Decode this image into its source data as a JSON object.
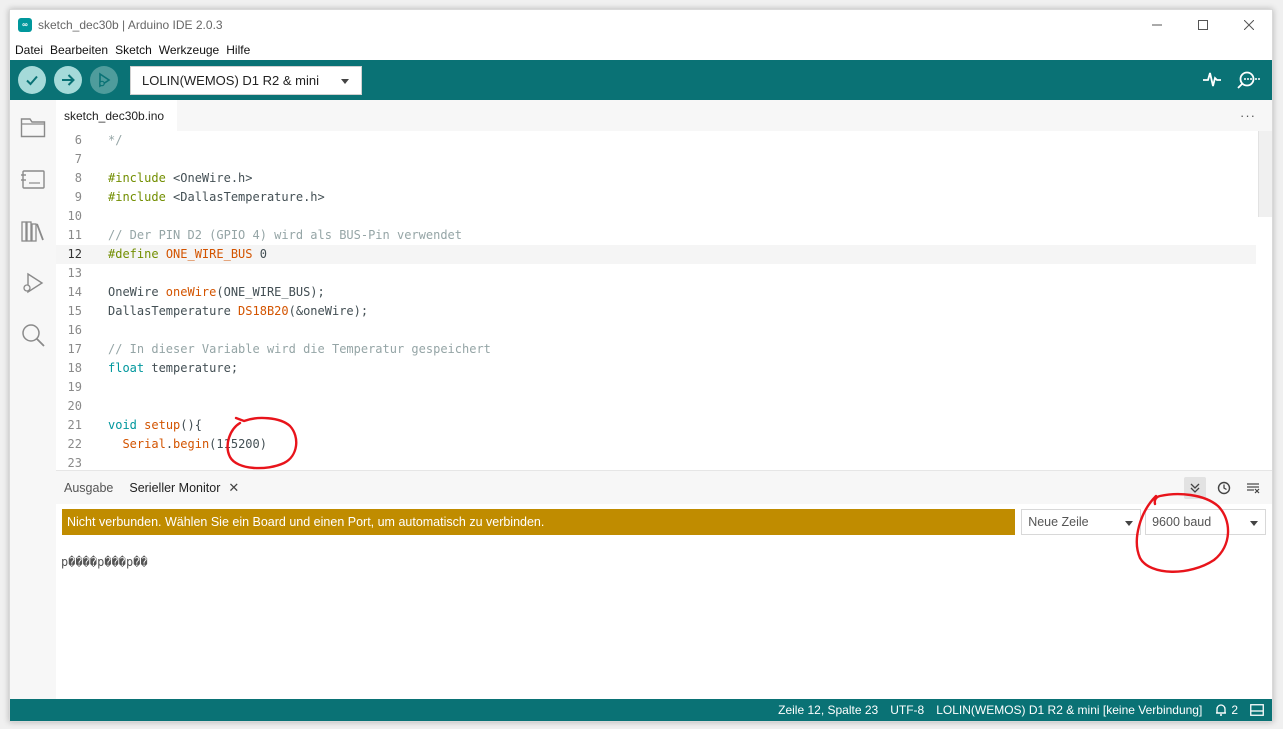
{
  "window": {
    "title": "sketch_dec30b | Arduino IDE 2.0.3",
    "logo_glyph": "∞"
  },
  "window_controls": {
    "minimize": "—",
    "maximize": "☐",
    "close": "✕"
  },
  "menu": [
    "Datei",
    "Bearbeiten",
    "Sketch",
    "Werkzeuge",
    "Hilfe"
  ],
  "toolbar": {
    "board": "LOLIN(WEMOS) D1 R2 & mini",
    "icons": [
      "verify-icon",
      "upload-icon",
      "debug-icon",
      "serial-plotter-icon",
      "serial-monitor-icon"
    ]
  },
  "sidebar": {
    "icons": [
      "folder-icon",
      "boards-manager-icon",
      "library-icon",
      "debug-icon",
      "search-icon"
    ]
  },
  "editor": {
    "tab": "sketch_dec30b.ino",
    "more": "···",
    "current_line": "12",
    "lines": [
      {
        "n": "6",
        "segs": [
          {
            "c": "c-comment",
            "t": "*/"
          }
        ]
      },
      {
        "n": "7",
        "segs": []
      },
      {
        "n": "8",
        "segs": [
          {
            "c": "c-kw",
            "t": "#include"
          },
          {
            "c": "",
            "t": " <OneWire.h>"
          }
        ]
      },
      {
        "n": "9",
        "segs": [
          {
            "c": "c-kw",
            "t": "#include"
          },
          {
            "c": "",
            "t": " <DallasTemperature.h>"
          }
        ]
      },
      {
        "n": "10",
        "segs": []
      },
      {
        "n": "11",
        "segs": [
          {
            "c": "c-comment",
            "t": "// Der PIN D2 (GPIO 4) wird als BUS-Pin verwendet"
          }
        ]
      },
      {
        "n": "12",
        "segs": [
          {
            "c": "c-kw",
            "t": "#define"
          },
          {
            "c": "",
            "t": " "
          },
          {
            "c": "c-fn",
            "t": "ONE_WIRE_BUS"
          },
          {
            "c": "",
            "t": " 0"
          }
        ]
      },
      {
        "n": "13",
        "segs": []
      },
      {
        "n": "14",
        "segs": [
          {
            "c": "",
            "t": "OneWire "
          },
          {
            "c": "c-fn",
            "t": "oneWire"
          },
          {
            "c": "",
            "t": "(ONE_WIRE_BUS);"
          }
        ]
      },
      {
        "n": "15",
        "segs": [
          {
            "c": "",
            "t": "DallasTemperature "
          },
          {
            "c": "c-fn",
            "t": "DS18B20"
          },
          {
            "c": "",
            "t": "(&oneWire);"
          }
        ]
      },
      {
        "n": "16",
        "segs": []
      },
      {
        "n": "17",
        "segs": [
          {
            "c": "c-comment",
            "t": "// In dieser Variable wird die Temperatur gespeichert"
          }
        ]
      },
      {
        "n": "18",
        "segs": [
          {
            "c": "c-type",
            "t": "float"
          },
          {
            "c": "",
            "t": " temperature;"
          }
        ]
      },
      {
        "n": "19",
        "segs": []
      },
      {
        "n": "20",
        "segs": []
      },
      {
        "n": "21",
        "segs": [
          {
            "c": "c-type",
            "t": "void"
          },
          {
            "c": "",
            "t": " "
          },
          {
            "c": "c-fn",
            "t": "setup"
          },
          {
            "c": "",
            "t": "(){"
          }
        ]
      },
      {
        "n": "22",
        "segs": [
          {
            "c": "",
            "t": "  "
          },
          {
            "c": "c-fn",
            "t": "Serial"
          },
          {
            "c": "",
            "t": "."
          },
          {
            "c": "c-fn",
            "t": "begin"
          },
          {
            "c": "",
            "t": "(115200)"
          }
        ]
      },
      {
        "n": "23",
        "segs": []
      }
    ]
  },
  "panel": {
    "tabs": [
      {
        "label": "Ausgabe",
        "active": false
      },
      {
        "label": "Serieller Monitor",
        "active": true
      }
    ],
    "close_glyph": "✕",
    "warning": "Nicht verbunden. Wählen Sie ein Board und einen Port, um automatisch zu verbinden.",
    "line_ending": "Neue Zeile",
    "baud": "9600 baud",
    "output": "p����p���p��"
  },
  "status": {
    "position": "Zeile 12, Spalte 23",
    "encoding": "UTF-8",
    "board": "LOLIN(WEMOS) D1 R2 & mini [keine Verbindung]",
    "notifications": "2"
  },
  "colors": {
    "teal": "#0a7275",
    "warning": "#c08c00",
    "annotation": "#e8141b"
  }
}
